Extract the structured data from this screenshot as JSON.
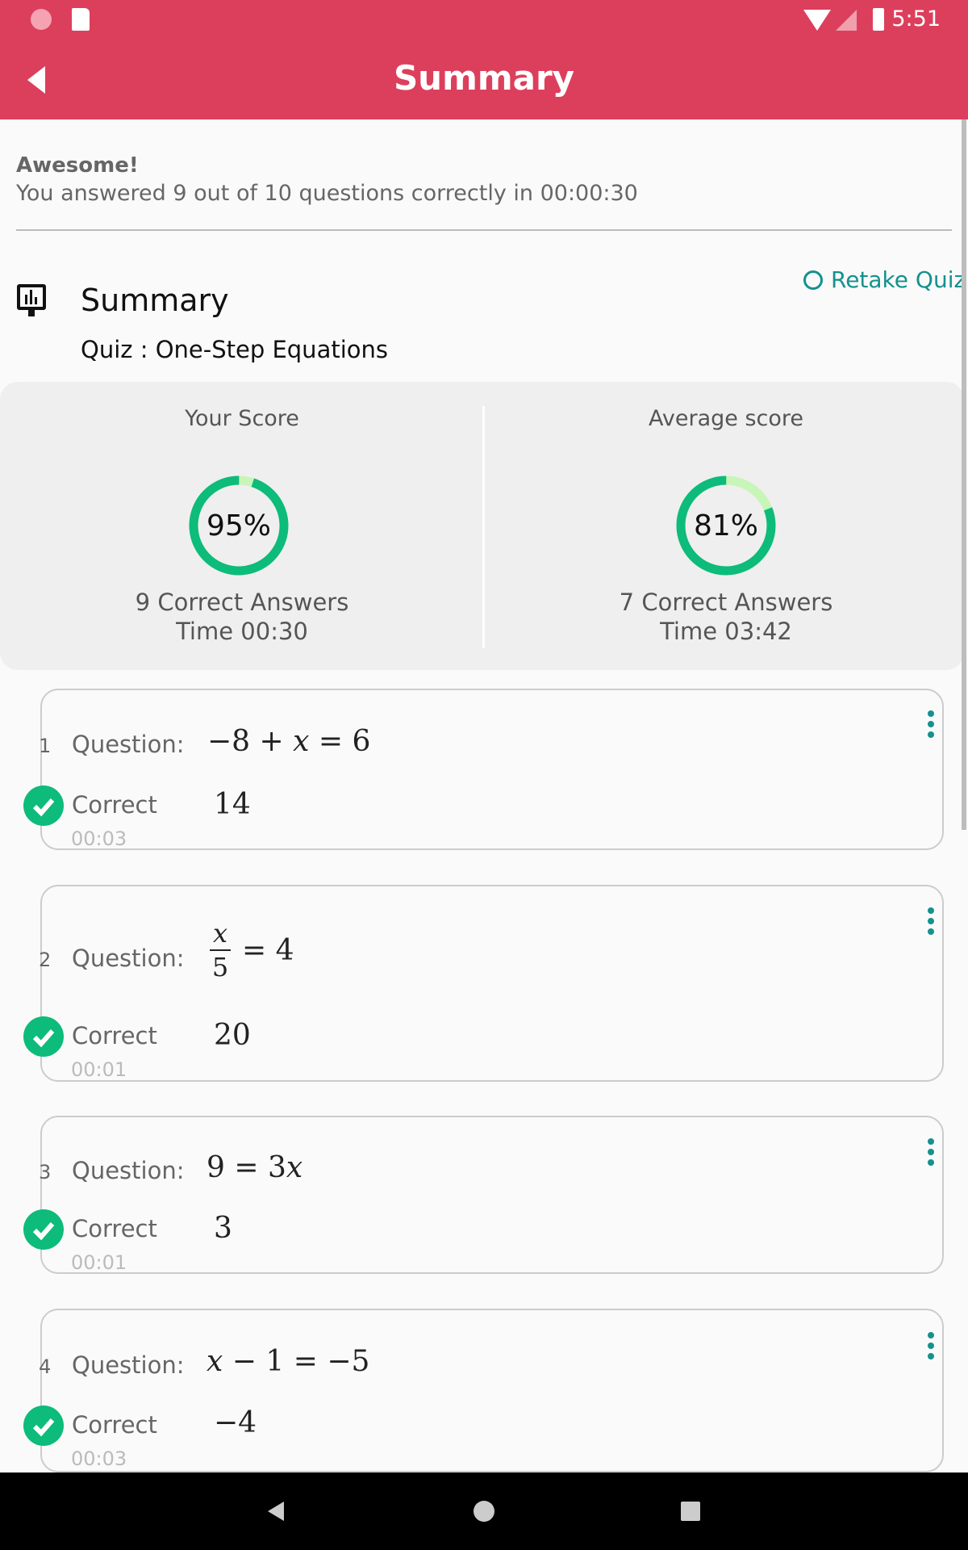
{
  "status_bar": {
    "time": "5:51"
  },
  "toolbar": {
    "title": "Summary"
  },
  "result": {
    "headline": "Awesome!",
    "message": "You answered 9 out of 10 questions correctly in 00:00:30"
  },
  "summary": {
    "title": "Summary",
    "quiz": "Quiz : One-Step Equations",
    "retake_label": "Retake Quiz"
  },
  "scores": {
    "yours": {
      "label": "Your Score",
      "percent_text": "95%",
      "percent": 95,
      "correct": "9 Correct Answers",
      "time": "Time 00:30"
    },
    "average": {
      "label": "Average score",
      "percent_text": "81%",
      "percent": 81,
      "correct": "7 Correct Answers",
      "time": "Time 03:42"
    }
  },
  "questions": [
    {
      "num": "1",
      "label": "Question:",
      "status": "Correct",
      "answer": "14",
      "time": "00:03"
    },
    {
      "num": "2",
      "label": "Question:",
      "status": "Correct",
      "answer": "20",
      "time": "00:01"
    },
    {
      "num": "3",
      "label": "Question:",
      "status": "Correct",
      "answer": "3",
      "time": "00:01"
    },
    {
      "num": "4",
      "label": "Question:",
      "status": "Correct",
      "answer": "−4",
      "time": "00:03"
    }
  ],
  "colors": {
    "primary": "#dc3f5c",
    "accent": "#15918e",
    "correct": "#0dbb7a",
    "ring_light": "#c8f5b8"
  }
}
